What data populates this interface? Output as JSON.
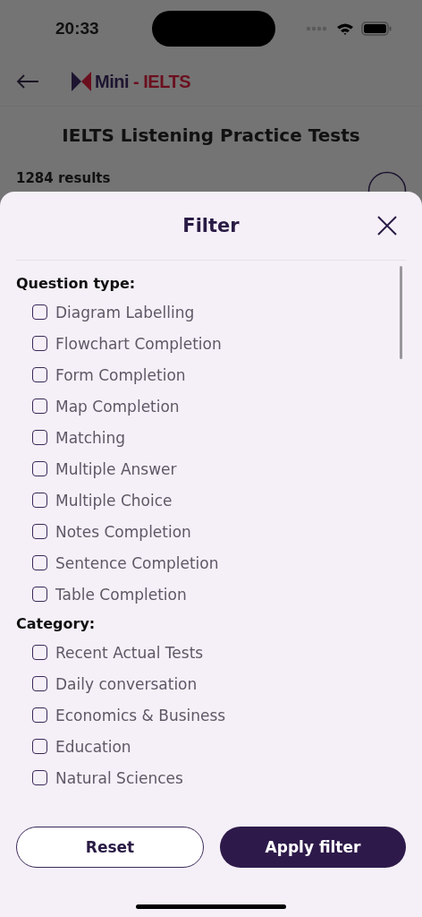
{
  "status_bar": {
    "time": "20:33"
  },
  "header": {
    "logo": {
      "first": "Mini",
      "second": "- IELTS"
    }
  },
  "page": {
    "title": "IELTS Listening Practice Tests",
    "results": "1284 results"
  },
  "filter": {
    "title": "Filter",
    "sections": [
      {
        "heading": "Question type:",
        "options": [
          {
            "label": "Diagram Labelling",
            "checked": false
          },
          {
            "label": "Flowchart Completion",
            "checked": false
          },
          {
            "label": "Form Completion",
            "checked": false
          },
          {
            "label": "Map Completion",
            "checked": false
          },
          {
            "label": "Matching",
            "checked": false
          },
          {
            "label": "Multiple Answer",
            "checked": false
          },
          {
            "label": "Multiple Choice",
            "checked": false
          },
          {
            "label": "Notes Completion",
            "checked": false
          },
          {
            "label": "Sentence Completion",
            "checked": false
          },
          {
            "label": "Table Completion",
            "checked": false
          }
        ]
      },
      {
        "heading": "Category:",
        "options": [
          {
            "label": "Recent Actual Tests",
            "checked": false
          },
          {
            "label": "Daily conversation",
            "checked": false
          },
          {
            "label": "Economics & Business",
            "checked": false
          },
          {
            "label": "Education",
            "checked": false
          },
          {
            "label": "Natural Sciences",
            "checked": false
          }
        ]
      }
    ],
    "buttons": [
      {
        "label": "Reset",
        "kind": "secondary"
      },
      {
        "label": "Apply filter",
        "kind": "primary"
      }
    ]
  }
}
